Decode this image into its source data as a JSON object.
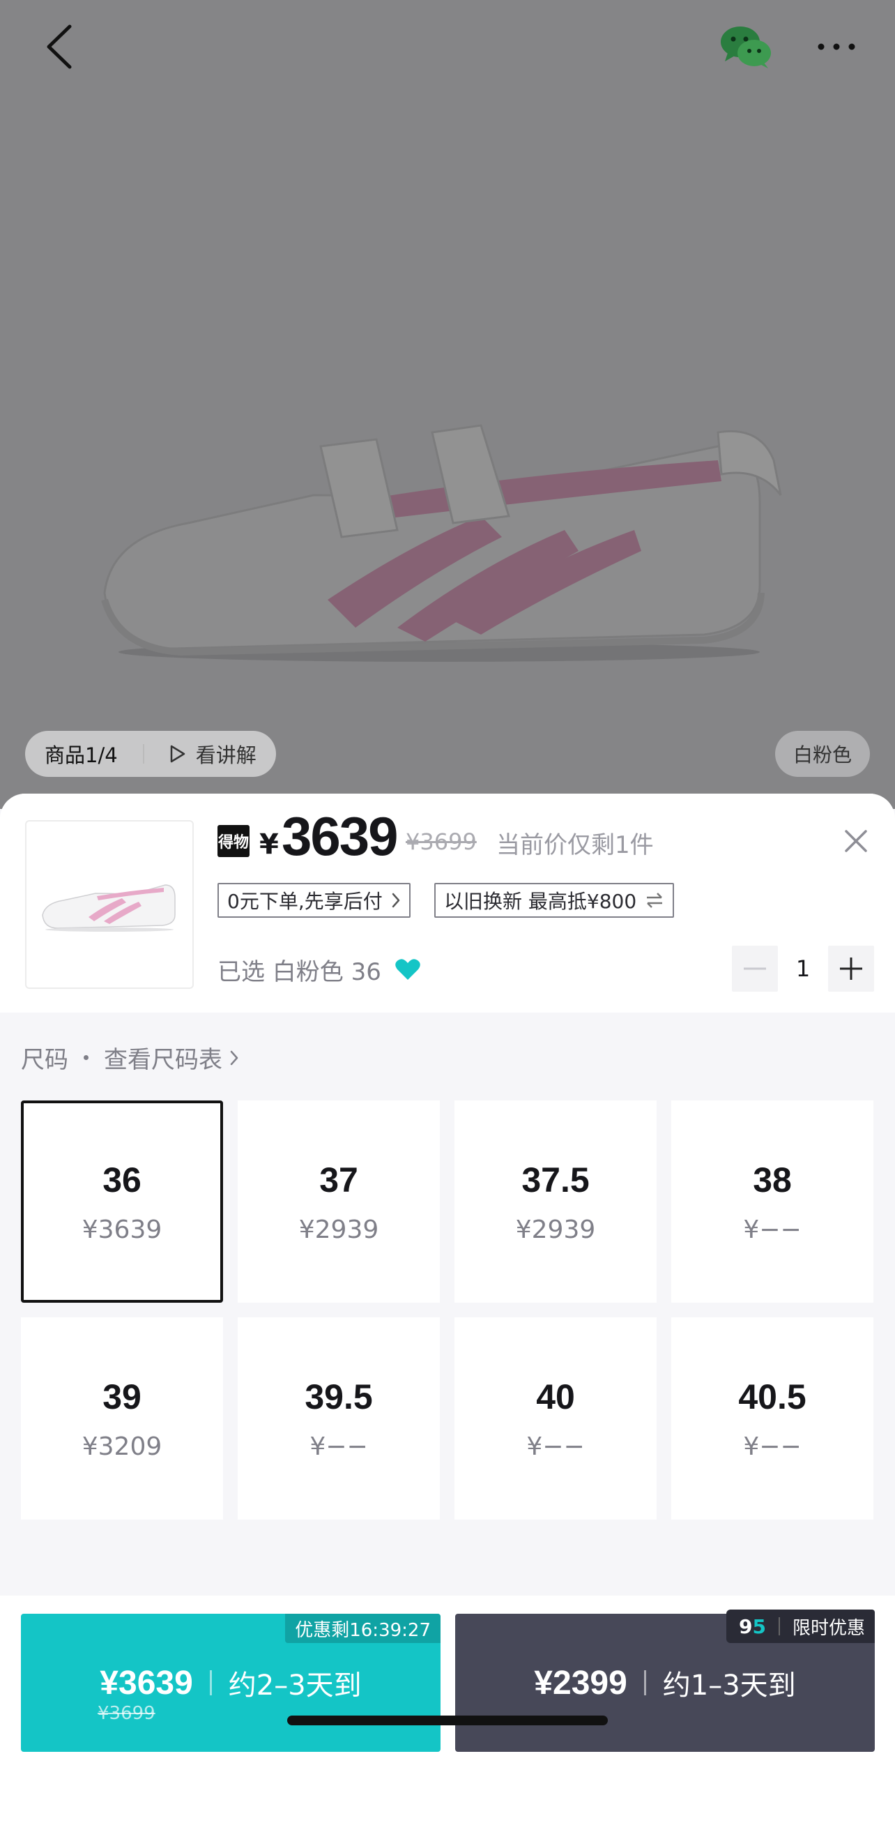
{
  "hero": {
    "tab_product": "商品1/4",
    "tab_video": "看讲解",
    "color_tag": "白粉色"
  },
  "header": {
    "brand_badge": "得物",
    "currency": "¥",
    "price": "3639",
    "original_price": "¥3699",
    "stock_note": "当前价仅剩1件"
  },
  "promos": {
    "pay_later": "0元下单,先享后付",
    "trade_in": "以旧换新 最高抵¥800"
  },
  "selection": {
    "label": "已选  白粉色  36",
    "quantity": "1"
  },
  "size_section": {
    "title": "尺码",
    "chart_link": "查看尺码表"
  },
  "sizes": [
    {
      "size": "36",
      "price": "¥3639"
    },
    {
      "size": "37",
      "price": "¥2939"
    },
    {
      "size": "37.5",
      "price": "¥2939"
    },
    {
      "size": "38",
      "price": "¥−−"
    },
    {
      "size": "39",
      "price": "¥3209"
    },
    {
      "size": "39.5",
      "price": "¥−−"
    },
    {
      "size": "40",
      "price": "¥−−"
    },
    {
      "size": "40.5",
      "price": "¥−−"
    }
  ],
  "buy_options": [
    {
      "price": "¥3639",
      "original": "¥3699",
      "eta": "约2–3天到",
      "badge": "优惠剩16:39:27"
    },
    {
      "price": "¥2399",
      "eta": "约1–3天到",
      "badge_number": "9",
      "badge_number_accent": "5",
      "badge_text": "限时优惠"
    }
  ],
  "colors": {
    "accent_teal": "#14c5c6",
    "dark_button": "#474858",
    "shoe_pink": "#e7a9c8",
    "wechat_green": "#2aae67"
  }
}
